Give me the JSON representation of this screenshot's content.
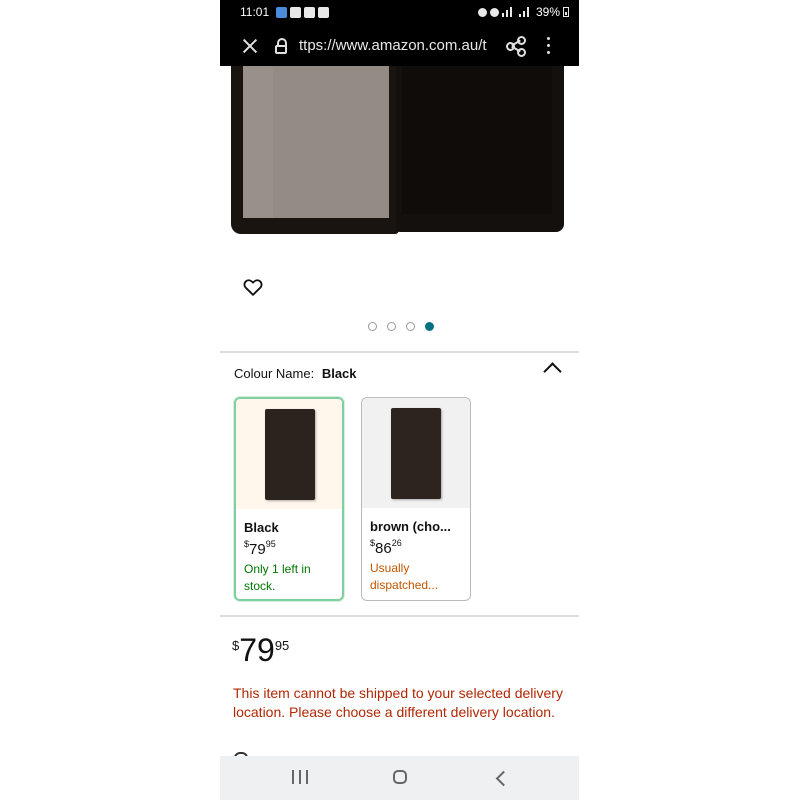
{
  "status_bar": {
    "time": "11:01",
    "battery": "39%"
  },
  "browser": {
    "url": "https://www.amazon.com.au/",
    "url_display": "ttps://www.amazon.com.au/t"
  },
  "gallery": {
    "image_count": 4,
    "active_index": 4
  },
  "colour": {
    "label": "Colour Name:",
    "selected": "Black"
  },
  "swatches": [
    {
      "name": "Black",
      "price_symbol": "$",
      "price_whole": "79",
      "price_fraction": "95",
      "availability": "Only 1 left in stock.",
      "selected": true,
      "availability_color": "#007600"
    },
    {
      "name": "brown (cho...",
      "price_symbol": "$",
      "price_whole": "86",
      "price_fraction": "26",
      "availability": "Usually dispatched...",
      "selected": false,
      "availability_color": "#c45500"
    }
  ],
  "price": {
    "symbol": "$",
    "whole": "79",
    "fraction": "95"
  },
  "shipping_warning": "This item cannot be shipped to your selected delivery location. Please choose a different delivery location.",
  "colors": {
    "accent": "#007185",
    "warning": "#b12704",
    "in_stock": "#007600",
    "dispatch": "#c45500",
    "selected_border": "#7fcfa0"
  },
  "icons": [
    "close-icon",
    "lock-icon",
    "share-icon",
    "more-vert-icon",
    "heart-icon",
    "chevron-up-icon",
    "recents-icon",
    "home-icon",
    "back-icon"
  ]
}
